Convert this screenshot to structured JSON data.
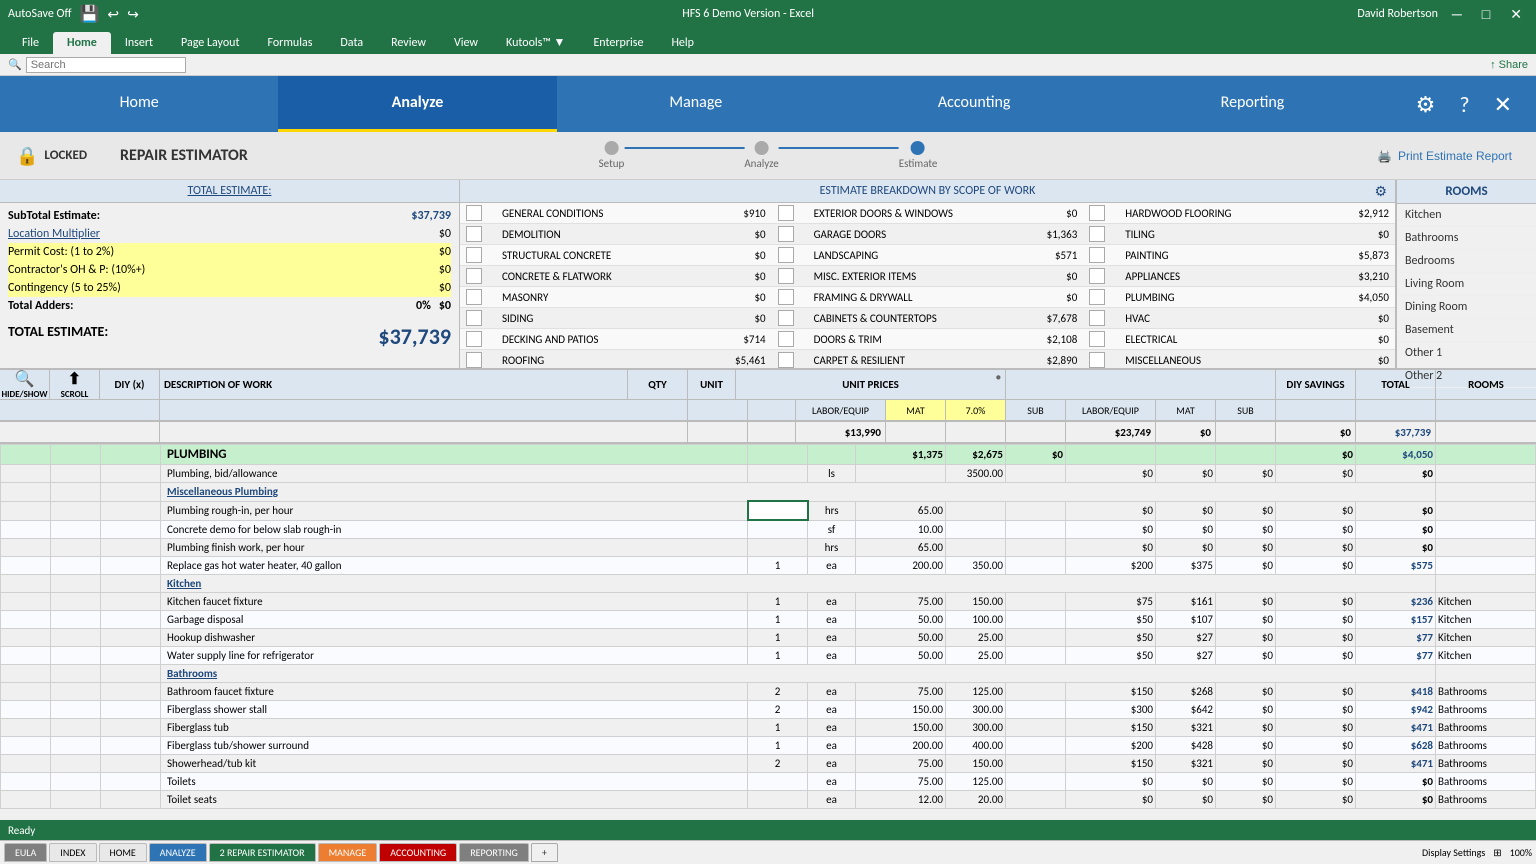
{
  "titlebar": {
    "left": "AutoSave  Off",
    "center": "HFS 6 Demo Version - Excel",
    "right": "David Robertson",
    "save_icon": "💾",
    "undo_icon": "↩",
    "redo_icon": "↪"
  },
  "ribbon_tabs": [
    "File",
    "Home",
    "Insert",
    "Page Layout",
    "Formulas",
    "Data",
    "Review",
    "View",
    "Kutools™ ▼",
    "Enterprise",
    "Help"
  ],
  "search_placeholder": "Search",
  "app_nav": {
    "items": [
      "Home",
      "Analyze",
      "Manage",
      "Accounting",
      "Reporting"
    ],
    "active": "Analyze",
    "icons": [
      "⚙",
      "?",
      "✕"
    ]
  },
  "progress": {
    "steps": [
      "Setup",
      "Analyze",
      "Estimate"
    ],
    "active_step": 2
  },
  "print_label": "Print Estimate Report",
  "locked_label": "LOCKED",
  "page_title": "REPAIR ESTIMATOR",
  "estimate_summary": {
    "header": "TOTAL ESTIMATE:",
    "rows": [
      {
        "label": "SubTotal Estimate:",
        "value": "$37,739",
        "bold": true
      },
      {
        "label": "Location Multiplier",
        "value": "$0",
        "link": true
      },
      {
        "label": "Permit Cost: (1 to 2%)",
        "value": "$0"
      },
      {
        "label": "Contractor's  OH & P: (10%+)",
        "value": "$0"
      },
      {
        "label": "Contingency (5 to 25%)",
        "value": "$0"
      },
      {
        "label": "Total Adders:",
        "value": "$0",
        "bold": true,
        "pct": "0%"
      },
      {
        "label": "TOTAL ESTIMATE:",
        "value": "$37,739",
        "big": true
      }
    ]
  },
  "breakdown": {
    "header": "ESTIMATE BREAKDOWN BY SCOPE OF WORK",
    "items": [
      {
        "label": "GENERAL CONDITIONS",
        "value": "$910"
      },
      {
        "label": "DEMOLITION",
        "value": "$0"
      },
      {
        "label": "STRUCTURAL CONCRETE",
        "value": "$0"
      },
      {
        "label": "CONCRETE & FLATWORK",
        "value": "$0"
      },
      {
        "label": "MASONRY",
        "value": "$0"
      },
      {
        "label": "SIDING",
        "value": "$0"
      },
      {
        "label": "DECKING AND PATIOS",
        "value": "$714"
      },
      {
        "label": "ROOFING",
        "value": "$5,461"
      },
      {
        "label": "EXTERIOR DOORS & WINDOWS",
        "value": "$0"
      },
      {
        "label": "GARAGE DOORS",
        "value": "$1,363"
      },
      {
        "label": "LANDSCAPING",
        "value": "$571"
      },
      {
        "label": "MISC. EXTERIOR ITEMS",
        "value": "$0"
      },
      {
        "label": "FRAMING & DRYWALL",
        "value": "$0"
      },
      {
        "label": "CABINETS & COUNTERTOPS",
        "value": "$7,678"
      },
      {
        "label": "DOORS & TRIM",
        "value": "$2,108"
      },
      {
        "label": "CARPET & RESILIENT",
        "value": "$2,890"
      },
      {
        "label": "HARDWOOD FLOORING",
        "value": "$2,912"
      },
      {
        "label": "TILING",
        "value": "$0"
      },
      {
        "label": "PAINTING",
        "value": "$5,873"
      },
      {
        "label": "APPLIANCES",
        "value": "$3,210"
      },
      {
        "label": "PLUMBING",
        "value": "$4,050"
      },
      {
        "label": "HVAC",
        "value": "$0"
      },
      {
        "label": "ELECTRICAL",
        "value": "$0"
      },
      {
        "label": "MISCELLANEOUS",
        "value": "$0"
      }
    ]
  },
  "rooms": {
    "header": "ROOMS",
    "items": [
      "Kitchen",
      "Bathrooms",
      "Bedrooms",
      "Living Room",
      "Dining Room",
      "Basement",
      "Other 1",
      "Other 2"
    ],
    "footer_label": "ROOMS"
  },
  "table_headers": {
    "diy": "DIY (x)",
    "desc": "DESCRIPTION OF WORK",
    "qty": "QTY",
    "unit": "UNIT",
    "unit_prices": "UNIT PRICES",
    "labor_equip1": "LABOR/EQUIP",
    "mat": "MAT",
    "mat_pct": "7.0%",
    "sub": "SUB",
    "labor_equip2": "LABOR/EQUIP",
    "mat2": "MAT",
    "sub2": "SUB",
    "diy_savings": "DIY SAVINGS",
    "total": "TOTAL"
  },
  "totals_bar": {
    "labor_equip1": "$13,990",
    "mat": "$23,749",
    "sub": "$0",
    "labor_equip2": "$0",
    "total": "$37,739"
  },
  "data_rows": [
    {
      "type": "section",
      "label": "PLUMBING",
      "labor": "$1,375",
      "mat": "$2,675",
      "sub": "$0",
      "diy": "$0",
      "total": "$4,050"
    },
    {
      "type": "item",
      "label": "Plumbing, bid/allowance",
      "qty": "",
      "unit": "ls",
      "lequip": "",
      "mat": "3500.00",
      "sub": "",
      "l2": "$0",
      "mat2": "$0",
      "sub2": "$0",
      "diy": "$0",
      "total": "$0",
      "room": ""
    },
    {
      "type": "category",
      "label": "Miscellaneous Plumbing"
    },
    {
      "type": "item",
      "label": "Plumbing rough-in, per hour",
      "qty": "",
      "unit": "hrs",
      "lequip": "65.00",
      "mat": "",
      "sub": "",
      "l2": "$0",
      "mat2": "$0",
      "sub2": "$0",
      "diy": "$0",
      "total": "$0",
      "room": "",
      "input": true
    },
    {
      "type": "item",
      "label": "Concrete demo for below slab rough-in",
      "qty": "",
      "unit": "sf",
      "lequip": "10.00",
      "mat": "",
      "sub": "",
      "l2": "$0",
      "mat2": "$0",
      "sub2": "$0",
      "diy": "$0",
      "total": "$0",
      "room": ""
    },
    {
      "type": "item",
      "label": "Plumbing finish work, per hour",
      "qty": "",
      "unit": "hrs",
      "lequip": "65.00",
      "mat": "",
      "sub": "",
      "l2": "$0",
      "mat2": "$0",
      "sub2": "$0",
      "diy": "$0",
      "total": "$0",
      "room": ""
    },
    {
      "type": "item",
      "label": "Replace gas hot water heater, 40 gallon",
      "qty": "1",
      "unit": "ea",
      "lequip": "200.00",
      "mat": "350.00",
      "sub": "",
      "l2": "$200",
      "mat2": "$375",
      "sub2": "$0",
      "diy": "$0",
      "total": "$575",
      "room": ""
    },
    {
      "type": "category",
      "label": "Kitchen"
    },
    {
      "type": "item",
      "label": "Kitchen faucet fixture",
      "qty": "1",
      "unit": "ea",
      "lequip": "75.00",
      "mat": "150.00",
      "sub": "",
      "l2": "$75",
      "mat2": "$161",
      "sub2": "$0",
      "diy": "$0",
      "total": "$236",
      "room": "Kitchen"
    },
    {
      "type": "item",
      "label": "Garbage disposal",
      "qty": "1",
      "unit": "ea",
      "lequip": "50.00",
      "mat": "100.00",
      "sub": "",
      "l2": "$50",
      "mat2": "$107",
      "sub2": "$0",
      "diy": "$0",
      "total": "$157",
      "room": "Kitchen"
    },
    {
      "type": "item",
      "label": "Hookup dishwasher",
      "qty": "1",
      "unit": "ea",
      "lequip": "50.00",
      "mat": "25.00",
      "sub": "",
      "l2": "$50",
      "mat2": "$27",
      "sub2": "$0",
      "diy": "$0",
      "total": "$77",
      "room": "Kitchen"
    },
    {
      "type": "item",
      "label": "Water supply line for refrigerator",
      "qty": "1",
      "unit": "ea",
      "lequip": "50.00",
      "mat": "25.00",
      "sub": "",
      "l2": "$50",
      "mat2": "$27",
      "sub2": "$0",
      "diy": "$0",
      "total": "$77",
      "room": "Kitchen"
    },
    {
      "type": "category",
      "label": "Bathrooms"
    },
    {
      "type": "item",
      "label": "Bathroom faucet fixture",
      "qty": "2",
      "unit": "ea",
      "lequip": "75.00",
      "mat": "125.00",
      "sub": "",
      "l2": "$150",
      "mat2": "$268",
      "sub2": "$0",
      "diy": "$0",
      "total": "$418",
      "room": "Bathrooms"
    },
    {
      "type": "item",
      "label": "Fiberglass shower stall",
      "qty": "2",
      "unit": "ea",
      "lequip": "150.00",
      "mat": "300.00",
      "sub": "",
      "l2": "$300",
      "mat2": "$642",
      "sub2": "$0",
      "diy": "$0",
      "total": "$942",
      "room": "Bathrooms"
    },
    {
      "type": "item",
      "label": "Fiberglass tub",
      "qty": "1",
      "unit": "ea",
      "lequip": "150.00",
      "mat": "300.00",
      "sub": "",
      "l2": "$150",
      "mat2": "$321",
      "sub2": "$0",
      "diy": "$0",
      "total": "$471",
      "room": "Bathrooms"
    },
    {
      "type": "item",
      "label": "Fiberglass tub/shower surround",
      "qty": "1",
      "unit": "ea",
      "lequip": "200.00",
      "mat": "400.00",
      "sub": "",
      "l2": "$200",
      "mat2": "$428",
      "sub2": "$0",
      "diy": "$0",
      "total": "$628",
      "room": "Bathrooms"
    },
    {
      "type": "item",
      "label": "Showerhead/tub kit",
      "qty": "2",
      "unit": "ea",
      "lequip": "75.00",
      "mat": "150.00",
      "sub": "",
      "l2": "$150",
      "mat2": "$321",
      "sub2": "$0",
      "diy": "$0",
      "total": "$471",
      "room": "Bathrooms"
    },
    {
      "type": "item",
      "label": "Toilets",
      "qty": "",
      "unit": "ea",
      "lequip": "75.00",
      "mat": "125.00",
      "sub": "",
      "l2": "$0",
      "mat2": "$0",
      "sub2": "$0",
      "diy": "$0",
      "total": "$0",
      "room": "Bathrooms"
    },
    {
      "type": "item",
      "label": "Toilet seats",
      "qty": "",
      "unit": "ea",
      "lequip": "12.00",
      "mat": "20.00",
      "sub": "",
      "l2": "$0",
      "mat2": "$0",
      "sub2": "$0",
      "diy": "$0",
      "total": "$0",
      "room": "Bathrooms"
    }
  ],
  "bottom_tabs": [
    {
      "label": "EULA",
      "style": "gray"
    },
    {
      "label": "INDEX",
      "style": "normal"
    },
    {
      "label": "HOME",
      "style": "normal"
    },
    {
      "label": "ANALYZE",
      "style": "blue-tab"
    },
    {
      "label": "2 REPAIR ESTIMATOR",
      "style": "active-tab"
    },
    {
      "label": "MANAGE",
      "style": "orange"
    },
    {
      "label": "ACCOUNTING",
      "style": "dark-red"
    },
    {
      "label": "REPORTING",
      "style": "gray"
    },
    {
      "label": "+",
      "style": "plus-btn"
    }
  ],
  "status": {
    "left": "Ready",
    "right": "Display Settings   100%"
  }
}
